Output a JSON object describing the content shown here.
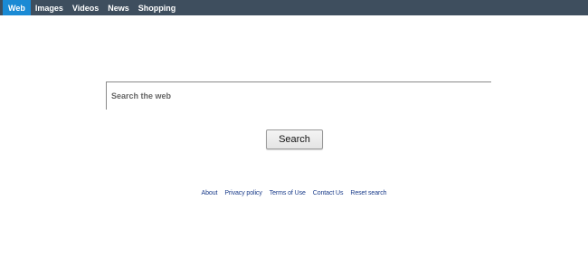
{
  "nav": {
    "tabs": [
      {
        "label": "Web",
        "active": true
      },
      {
        "label": "Images",
        "active": false
      },
      {
        "label": "Videos",
        "active": false
      },
      {
        "label": "News",
        "active": false
      },
      {
        "label": "Shopping",
        "active": false
      }
    ]
  },
  "search": {
    "placeholder": "Search the web",
    "value": "",
    "button_label": "Search"
  },
  "footer": {
    "links": [
      "About",
      "Privacy policy",
      "Terms of Use",
      "Contact Us",
      "Reset search"
    ]
  },
  "colors": {
    "topbar_bg": "#3e4e5e",
    "active_tab_bg": "#1a8ad4",
    "footer_link": "#1a3c8a"
  }
}
